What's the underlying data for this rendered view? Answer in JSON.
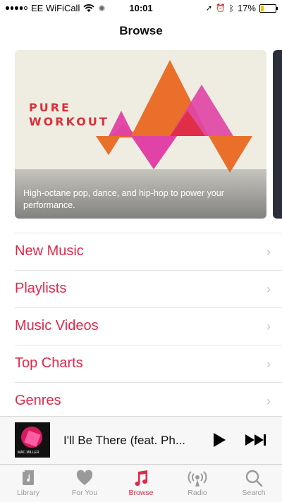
{
  "status_bar": {
    "carrier": "EE WiFiCall",
    "time": "10:01",
    "battery": "17%"
  },
  "nav": {
    "title": "Browse"
  },
  "featured": {
    "logo_line1": "PURE",
    "logo_line2": "WORKOUT",
    "description": "High-octane pop, dance, and hip-hop to power your performance."
  },
  "menu": {
    "items": [
      {
        "label": "New Music"
      },
      {
        "label": "Playlists"
      },
      {
        "label": "Music Videos"
      },
      {
        "label": "Top Charts"
      },
      {
        "label": "Genres"
      }
    ]
  },
  "player": {
    "artwork_caption": "MAC MILLER",
    "song_title": "I'll Be There (feat. Ph..."
  },
  "tabs": [
    {
      "label": "Library",
      "icon": "library-icon"
    },
    {
      "label": "For You",
      "icon": "heart-icon"
    },
    {
      "label": "Browse",
      "icon": "music-note-icon",
      "active": true
    },
    {
      "label": "Radio",
      "icon": "radio-icon"
    },
    {
      "label": "Search",
      "icon": "search-icon"
    }
  ],
  "colors": {
    "accent": "#e0284a",
    "inactive_tab": "#9a9a9a"
  }
}
